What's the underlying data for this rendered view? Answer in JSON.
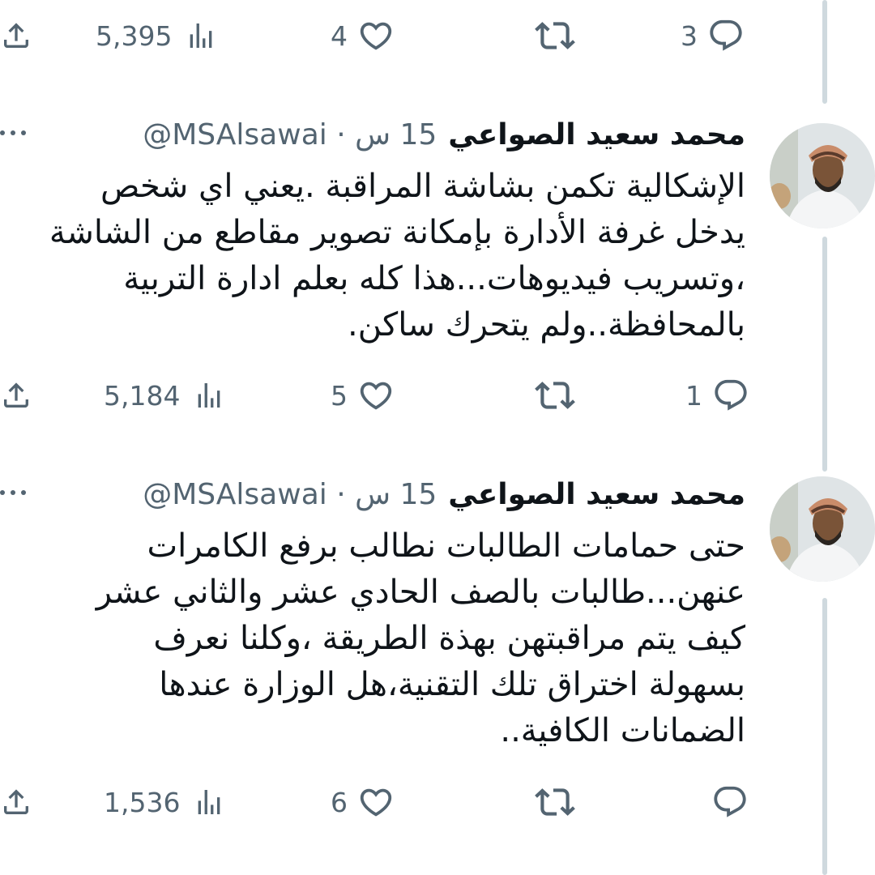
{
  "author": {
    "name": "محمد سعيد الصواعي",
    "handle": "@MSAlsawai",
    "time": "15 س"
  },
  "top_actions": {
    "views": "5,395",
    "likes": "4",
    "replies": "3"
  },
  "tweets": [
    {
      "lines": [
        "الإشكالية تكمن بشاشة المراقبة .يعني اي شخص",
        "يدخل غرفة الأدارة بإمكانة تصوير مقاطع من الشاشة",
        "،وتسريب فيديوهات...هذا كله بعلم ادارة التربية",
        "بالمحافظة..ولم يتحرك ساكن."
      ],
      "actions": {
        "views": "5,184",
        "likes": "5",
        "replies": "1"
      }
    },
    {
      "lines": [
        "حتى حمامات الطالبات نطالب برفع الكامرات",
        "عنهن...طالبات بالصف الحادي عشر والثاني عشر",
        "كيف يتم مراقبتهن بهذة الطريقة ،وكلنا نعرف",
        "بسهولة اختراق تلك التقنية،هل الوزارة عندها",
        "الضمانات الكافية.."
      ],
      "actions": {
        "views": "1,536",
        "likes": "6",
        "replies": ""
      }
    }
  ]
}
